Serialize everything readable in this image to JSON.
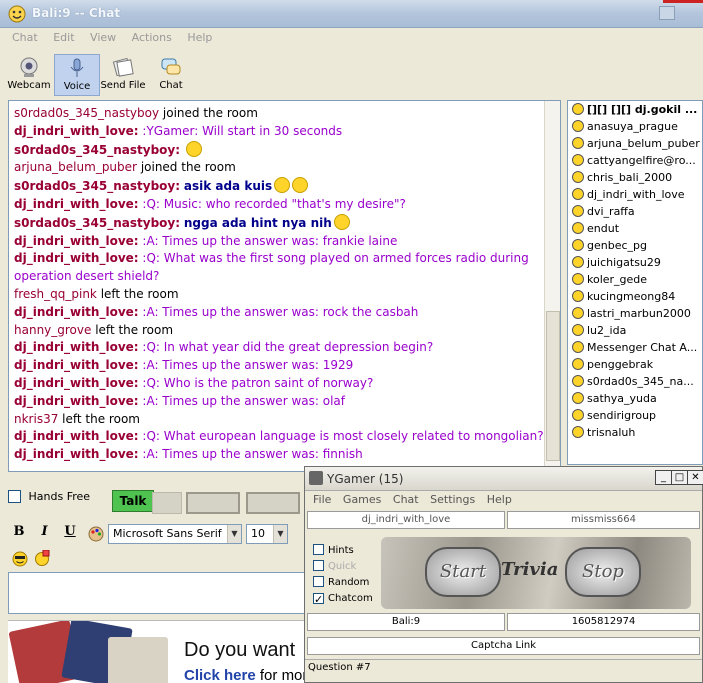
{
  "window": {
    "title": "Bali:9 -- Chat"
  },
  "menu": [
    "Chat",
    "Edit",
    "View",
    "Actions",
    "Help"
  ],
  "toolbar": [
    {
      "label": "Webcam",
      "icon": "webcam-icon"
    },
    {
      "label": "Voice",
      "icon": "microphone-icon"
    },
    {
      "label": "Send File",
      "icon": "send-file-icon"
    },
    {
      "label": "Chat",
      "icon": "chat-icon"
    }
  ],
  "transcript": [
    {
      "nick": "s0rdad0s_345_nastyboy",
      "kind": "event",
      "text": "joined the room"
    },
    {
      "nick": "dj_indri_with_love:",
      "kind": "msg",
      "text": ":YGamer: Will start in 30 seconds"
    },
    {
      "nick": "s0rdad0s_345_nastyboy:",
      "kind": "emote",
      "text": ""
    },
    {
      "nick": "arjuna_belum_puber",
      "kind": "event",
      "text": "joined the room"
    },
    {
      "nick": "s0rdad0s_345_nastyboy:",
      "kind": "bold",
      "text": "asik ada kuis"
    },
    {
      "nick": "dj_indri_with_love:",
      "kind": "msg",
      "text": ":Q: Music: who recorded \"that's my desire\"?"
    },
    {
      "nick": "s0rdad0s_345_nastyboy:",
      "kind": "bold",
      "text": "ngga ada hint nya nih"
    },
    {
      "nick": "dj_indri_with_love:",
      "kind": "answer",
      "prefix": ":A: Times up the answer was:",
      "text": "frankie laine"
    },
    {
      "nick": "dj_indri_with_love:",
      "kind": "msg",
      "text": ":Q: What was the first song played on armed forces radio during operation desert shield?"
    },
    {
      "nick": "fresh_qq_pink",
      "kind": "event",
      "text": "left the room"
    },
    {
      "nick": "dj_indri_with_love:",
      "kind": "answer",
      "prefix": ":A: Times up the answer was:",
      "text": "rock the casbah"
    },
    {
      "nick": "hanny_grove",
      "kind": "event",
      "text": "left the room"
    },
    {
      "nick": "dj_indri_with_love:",
      "kind": "msg",
      "text": ":Q: In what year did the great depression begin?"
    },
    {
      "nick": "dj_indri_with_love:",
      "kind": "answer",
      "prefix": ":A: Times up the answer was:",
      "text": "1929"
    },
    {
      "nick": "dj_indri_with_love:",
      "kind": "msg",
      "text": ":Q: Who is the patron saint of norway?"
    },
    {
      "nick": "dj_indri_with_love:",
      "kind": "answer",
      "prefix": ":A: Times up the answer was:",
      "text": "olaf"
    },
    {
      "nick": "nkris37",
      "kind": "event",
      "text": "left the room"
    },
    {
      "nick": "dj_indri_with_love:",
      "kind": "msg",
      "text": ":Q: What european language is most closely related to mongolian?"
    },
    {
      "nick": "dj_indri_with_love:",
      "kind": "answer",
      "prefix": ":A: Times up the answer was:",
      "text": "finnish"
    }
  ],
  "users": [
    "[][] [][] dj.gokil ...",
    "anasuya_prague",
    "arjuna_belum_puber",
    "cattyangelfire@ro...",
    "chris_bali_2000",
    "dj_indri_with_love",
    "dvi_raffa",
    "endut",
    "genbec_pg",
    "juichigatsu29",
    "koler_gede",
    "kucingmeong84",
    "lastri_marbun2000",
    "lu2_ida",
    "Messenger Chat A...",
    "penggebrak",
    "s0rdad0s_345_na...",
    "sathya_yuda",
    "sendirigroup",
    "trisnaluh"
  ],
  "controls": {
    "hands_free": "Hands Free",
    "talk": "Talk",
    "bold": "B",
    "italic": "I",
    "underline": "U",
    "font": "Microsoft Sans Serif",
    "size": "10"
  },
  "ad": {
    "headline": "Do you want",
    "link": "Click here",
    "rest": "for more information"
  },
  "ygamer": {
    "title": "YGamer (15)",
    "menu": [
      "File",
      "Games",
      "Chat",
      "Settings",
      "Help"
    ],
    "player1": "dj_indri_with_love",
    "player2": "missmiss664",
    "options": [
      {
        "label": "Hints",
        "checked": false,
        "disabled": false
      },
      {
        "label": "Quick",
        "checked": false,
        "disabled": true
      },
      {
        "label": "Random",
        "checked": false,
        "disabled": false
      },
      {
        "label": "Chatcom",
        "checked": true,
        "disabled": false
      }
    ],
    "start": "Start",
    "trivia": "Trivia",
    "stop": "Stop",
    "room": "Bali:9",
    "id": "1605812974",
    "captcha": "Captcha Link",
    "status": "Question #7"
  },
  "colors": {
    "nick": "#990033",
    "message": "#9900cc",
    "bold_message": "#00008b",
    "talk": "#4fc34f"
  }
}
